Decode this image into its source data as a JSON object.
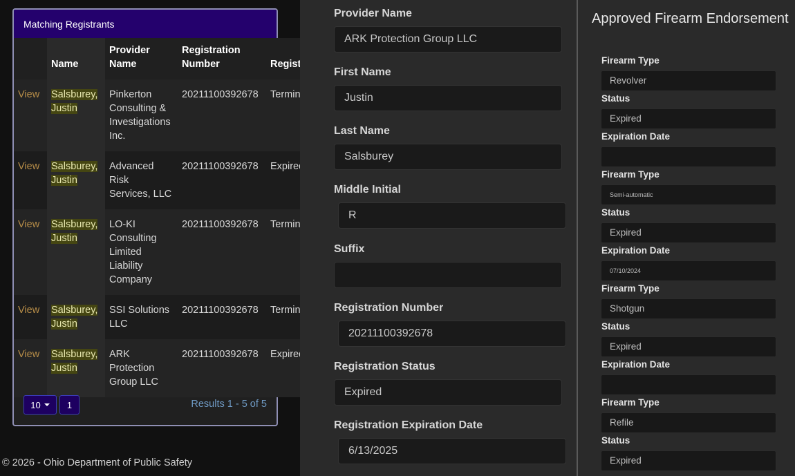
{
  "registrants": {
    "panel_title": "Matching Registrants",
    "columns": [
      "",
      "Name",
      "Provider Name",
      "Registration Number",
      "Registration Status"
    ],
    "rows": [
      {
        "action": "View",
        "name": "Salsburey, Justin",
        "provider": "Pinkerton Consulting & Investigations Inc.",
        "number": "20211100392678",
        "status": "Terminated"
      },
      {
        "action": "View",
        "name": "Salsburey, Justin",
        "provider": "Advanced Risk Services, LLC",
        "number": "20211100392678",
        "status": "Expired"
      },
      {
        "action": "View",
        "name": "Salsburey, Justin",
        "provider": "LO-KI Consulting Limited Liability Company",
        "number": "20211100392678",
        "status": "Terminated"
      },
      {
        "action": "View",
        "name": "Salsburey, Justin",
        "provider": "SSI Solutions LLC",
        "number": "20211100392678",
        "status": "Terminated"
      },
      {
        "action": "View",
        "name": "Salsburey, Justin",
        "provider": "ARK Protection Group LLC",
        "number": "20211100392678",
        "status": "Expired"
      }
    ],
    "page_size": "10",
    "current_page": "1",
    "results_text": "Results 1 - 5 of 5"
  },
  "footer": "© 2026 - Ohio Department of Public Safety",
  "details": {
    "fields": [
      {
        "label": "Provider Name",
        "value": "ARK Protection Group LLC"
      },
      {
        "label": "First Name",
        "value": "Justin"
      },
      {
        "label": "Last Name",
        "value": "Salsburey"
      },
      {
        "label": "Middle Initial",
        "value": "R"
      },
      {
        "label": "Suffix",
        "value": ""
      },
      {
        "label": "Registration Number",
        "value": "20211100392678"
      },
      {
        "label": "Registration Status",
        "value": "Expired"
      },
      {
        "label": "Registration Expiration Date",
        "value": "6/13/2025"
      }
    ]
  },
  "endorsement": {
    "title": "Approved Firearm Endorsement",
    "fields": [
      {
        "label": "Firearm Type",
        "value": "Revolver"
      },
      {
        "label": "Status",
        "value": "Expired"
      },
      {
        "label": "Expiration Date",
        "value": ""
      },
      {
        "label": "Firearm Type",
        "value": "Semi-automatic"
      },
      {
        "label": "Status",
        "value": "Expired"
      },
      {
        "label": "Expiration Date",
        "value": "07/10/2024"
      },
      {
        "label": "Firearm Type",
        "value": "Shotgun"
      },
      {
        "label": "Status",
        "value": "Expired"
      },
      {
        "label": "Expiration Date",
        "value": ""
      },
      {
        "label": "Firearm Type",
        "value": "Refile"
      },
      {
        "label": "Status",
        "value": "Expired"
      }
    ]
  }
}
